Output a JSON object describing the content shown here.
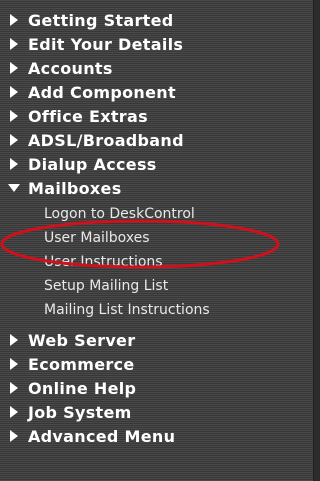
{
  "menu": {
    "top_items": [
      {
        "label": "Getting Started",
        "icon": "arrow-right-icon",
        "expanded": false
      },
      {
        "label": "Edit Your Details",
        "icon": "arrow-right-icon",
        "expanded": false
      },
      {
        "label": "Accounts",
        "icon": "arrow-right-icon",
        "expanded": false
      },
      {
        "label": "Add Component",
        "icon": "arrow-right-icon",
        "expanded": false
      },
      {
        "label": "Office Extras",
        "icon": "arrow-right-icon",
        "expanded": false
      },
      {
        "label": "ADSL/Broadband",
        "icon": "arrow-right-icon",
        "expanded": false
      },
      {
        "label": "Dialup Access",
        "icon": "arrow-right-icon",
        "expanded": false
      },
      {
        "label": "Mailboxes",
        "icon": "arrow-down-icon",
        "expanded": true
      }
    ],
    "mailboxes_sub_items": [
      {
        "label": "Logon to DeskControl"
      },
      {
        "label": "User Mailboxes",
        "highlighted": true
      },
      {
        "label": "User Instructions"
      },
      {
        "label": "Setup Mailing List"
      },
      {
        "label": "Mailing List Instructions"
      }
    ],
    "bottom_items": [
      {
        "label": "Web Server",
        "icon": "arrow-right-icon",
        "expanded": false
      },
      {
        "label": "Ecommerce",
        "icon": "arrow-right-icon",
        "expanded": false
      },
      {
        "label": "Online Help",
        "icon": "arrow-right-icon",
        "expanded": false
      },
      {
        "label": "Job System",
        "icon": "arrow-right-icon",
        "expanded": false
      },
      {
        "label": "Advanced Menu",
        "icon": "arrow-right-icon",
        "expanded": false
      }
    ]
  },
  "colors": {
    "background": "#404040",
    "text": "#ffffff",
    "sub_text": "#e8e8e8",
    "highlight_ellipse": "#d0101a"
  }
}
